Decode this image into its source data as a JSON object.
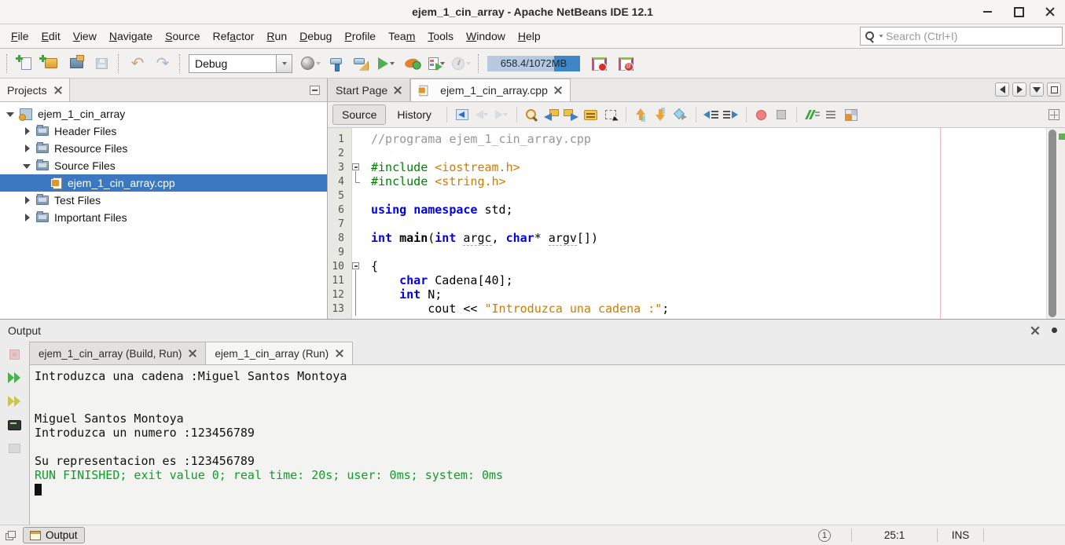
{
  "window": {
    "title": "ejem_1_cin_array - Apache NetBeans IDE 12.1"
  },
  "menu": {
    "items": [
      {
        "label": "File",
        "u": 0
      },
      {
        "label": "Edit",
        "u": 0
      },
      {
        "label": "View",
        "u": 0
      },
      {
        "label": "Navigate",
        "u": 0
      },
      {
        "label": "Source",
        "u": 0
      },
      {
        "label": "Refactor",
        "u": 3
      },
      {
        "label": "Run",
        "u": 0
      },
      {
        "label": "Debug",
        "u": 0
      },
      {
        "label": "Profile",
        "u": 0
      },
      {
        "label": "Team",
        "u": 3
      },
      {
        "label": "Tools",
        "u": 0
      },
      {
        "label": "Window",
        "u": 0
      },
      {
        "label": "Help",
        "u": 0
      }
    ]
  },
  "search": {
    "placeholder": "Search (Ctrl+I)"
  },
  "toolbar": {
    "config_value": "Debug",
    "memory": "658.4/1072MB",
    "memory_fill_pct": 72,
    "group_file": [
      {
        "n": "new-file",
        "i": "i-newfile"
      },
      {
        "n": "new-project",
        "i": "i-newproj"
      },
      {
        "n": "open-project",
        "i": "i-openproj"
      },
      {
        "n": "save-all",
        "i": "i-floppy",
        "disabled": true
      }
    ],
    "group_edit": [
      {
        "n": "undo",
        "i": "i-undo"
      },
      {
        "n": "redo",
        "i": "i-redo"
      }
    ],
    "group_run": [
      {
        "n": "deploy",
        "i": "i-globe",
        "dd": true,
        "dddis": true
      },
      {
        "n": "build-project",
        "i": "i-hammer"
      },
      {
        "n": "clean-build-project",
        "i": "i-cleanbuild"
      },
      {
        "n": "run-project",
        "i": "i-play",
        "dd": true
      },
      {
        "n": "debug-project",
        "i": "i-debug"
      },
      {
        "n": "profile-project",
        "i": "i-profile",
        "dd": true
      },
      {
        "n": "profile-gauge",
        "i": "i-gauge",
        "disabled": true,
        "dd": true,
        "dddis": true
      }
    ]
  },
  "projects": {
    "tab_title": "Projects",
    "tree": [
      {
        "label": "ejem_1_cin_array",
        "level": 0,
        "arrow": "open",
        "icon": "project"
      },
      {
        "label": "Header Files",
        "level": 1,
        "arrow": "closed",
        "icon": "folder"
      },
      {
        "label": "Resource Files",
        "level": 1,
        "arrow": "closed",
        "icon": "folder"
      },
      {
        "label": "Source Files",
        "level": 1,
        "arrow": "open",
        "icon": "folder"
      },
      {
        "label": "ejem_1_cin_array.cpp",
        "level": 2,
        "arrow": "none",
        "icon": "cppfile",
        "selected": true
      },
      {
        "label": "Test Files",
        "level": 1,
        "arrow": "closed",
        "icon": "folder"
      },
      {
        "label": "Important Files",
        "level": 1,
        "arrow": "closed",
        "icon": "folder"
      }
    ]
  },
  "editor": {
    "tabs": [
      {
        "label": "Start Page",
        "icon": null,
        "active": false
      },
      {
        "label": "ejem_1_cin_array.cpp",
        "icon": "cppfile",
        "active": true
      }
    ],
    "view_buttons": {
      "source": "Source",
      "history": "History"
    },
    "toolbar_groups": [
      [
        {
          "n": "last-edit-location",
          "i": "e-lastedit"
        },
        {
          "n": "back",
          "i": "e-back",
          "disabled": true,
          "dd": true,
          "dddis": true
        },
        {
          "n": "forward",
          "i": "e-forward",
          "disabled": true,
          "dd": true,
          "dddis": true
        }
      ],
      [
        {
          "n": "find-selection",
          "i": "e-findsel"
        },
        {
          "n": "find-previous",
          "i": "e-findprev"
        },
        {
          "n": "find-next",
          "i": "e-findnext"
        },
        {
          "n": "toggle-highlight-search",
          "i": "e-highlight"
        },
        {
          "n": "toggle-rectangular-selection",
          "i": "e-rectsel"
        }
      ],
      [
        {
          "n": "previous-bookmark",
          "i": "e-bmup"
        },
        {
          "n": "next-bookmark",
          "i": "e-bmdown"
        },
        {
          "n": "toggle-bookmark",
          "i": "e-bmtoggle"
        }
      ],
      [
        {
          "n": "shift-line-left",
          "i": "e-shiftl"
        },
        {
          "n": "shift-line-right",
          "i": "e-shiftr"
        }
      ],
      [
        {
          "n": "start-macro-recording",
          "i": "e-record"
        },
        {
          "n": "stop-macro-recording",
          "i": "e-stop"
        }
      ],
      [
        {
          "n": "comment",
          "i": "e-comment"
        },
        {
          "n": "uncomment",
          "i": "e-uncomment"
        },
        {
          "n": "toggle-header-source",
          "i": "e-headersrc"
        }
      ]
    ],
    "code_lines": [
      {
        "n": 1,
        "f": "",
        "segs": [
          [
            "c",
            "//programa ejem_1_cin_array.cpp"
          ]
        ]
      },
      {
        "n": 2,
        "f": "",
        "segs": []
      },
      {
        "n": 3,
        "f": "s",
        "segs": [
          [
            "d",
            "#include "
          ],
          [
            "s",
            "<iostream.h>"
          ]
        ]
      },
      {
        "n": 4,
        "f": "e",
        "segs": [
          [
            "d",
            "#include "
          ],
          [
            "s",
            "<string.h>"
          ]
        ]
      },
      {
        "n": 5,
        "f": "",
        "segs": []
      },
      {
        "n": 6,
        "f": "",
        "segs": [
          [
            "k",
            "using"
          ],
          [
            "p",
            " "
          ],
          [
            "k",
            "namespace"
          ],
          [
            "p",
            " std;"
          ]
        ]
      },
      {
        "n": 7,
        "f": "",
        "segs": []
      },
      {
        "n": 8,
        "f": "",
        "segs": [
          [
            "k",
            "int"
          ],
          [
            "p",
            " "
          ],
          [
            "fn",
            "main"
          ],
          [
            "p",
            "("
          ],
          [
            "k",
            "int"
          ],
          [
            "p",
            " "
          ],
          [
            "a",
            "argc"
          ],
          [
            "p",
            ", "
          ],
          [
            "k",
            "char"
          ],
          [
            "p",
            "* "
          ],
          [
            "a",
            "argv"
          ],
          [
            "p",
            "[])"
          ]
        ]
      },
      {
        "n": 9,
        "f": "",
        "segs": []
      },
      {
        "n": 10,
        "f": "s",
        "segs": [
          [
            "p",
            "{"
          ]
        ]
      },
      {
        "n": 11,
        "f": "c",
        "segs": [
          [
            "p",
            "    "
          ],
          [
            "k",
            "char"
          ],
          [
            "p",
            " Cadena[40];"
          ]
        ]
      },
      {
        "n": 12,
        "f": "c",
        "segs": [
          [
            "p",
            "    "
          ],
          [
            "k",
            "int"
          ],
          [
            "p",
            " N;"
          ]
        ]
      },
      {
        "n": 13,
        "f": "c",
        "segs": [
          [
            "p",
            "        cout << "
          ],
          [
            "s",
            "\"Introduzca una cadena :\""
          ],
          [
            "p",
            ";"
          ]
        ]
      }
    ]
  },
  "output": {
    "title": "Output",
    "strip": [
      {
        "n": "stop-process",
        "i": "o-stop",
        "disabled": true
      },
      {
        "n": "rerun",
        "i": "o-rerun"
      },
      {
        "n": "rerun-with-args",
        "i": "o-rerun2"
      },
      {
        "n": "open-in-terminal",
        "i": "o-term"
      },
      {
        "n": "output-settings",
        "i": "o-settings",
        "disabled": true
      }
    ],
    "tabs": [
      {
        "label": "ejem_1_cin_array (Build, Run)",
        "active": false
      },
      {
        "label": "ejem_1_cin_array (Run)",
        "active": true
      }
    ],
    "console": [
      {
        "t": "Introduzca una cadena :Miguel Santos Montoya",
        "c": "p"
      },
      {
        "t": "",
        "c": "p"
      },
      {
        "t": "",
        "c": "p"
      },
      {
        "t": "Miguel Santos Montoya",
        "c": "p"
      },
      {
        "t": "Introduzca un numero :123456789",
        "c": "p"
      },
      {
        "t": "",
        "c": "p"
      },
      {
        "t": "Su representacion es :123456789",
        "c": "p"
      },
      {
        "t": "RUN FINISHED; exit value 0; real time: 20s; user: 0ms; system: 0ms",
        "c": "g"
      }
    ],
    "cursor": true
  },
  "statusbar": {
    "output_button": "Output",
    "notification_count": "1",
    "caret": "25:1",
    "mode": "INS"
  },
  "colors": {
    "selection_blue": "#3c78c0",
    "run_finished_green": "#0ca024",
    "memory_blue": "#3f86c9",
    "keyword_blue": "#0000e6",
    "string_orange": "#ce7b00",
    "directive_green": "#008000",
    "comment_gray": "#969696"
  }
}
